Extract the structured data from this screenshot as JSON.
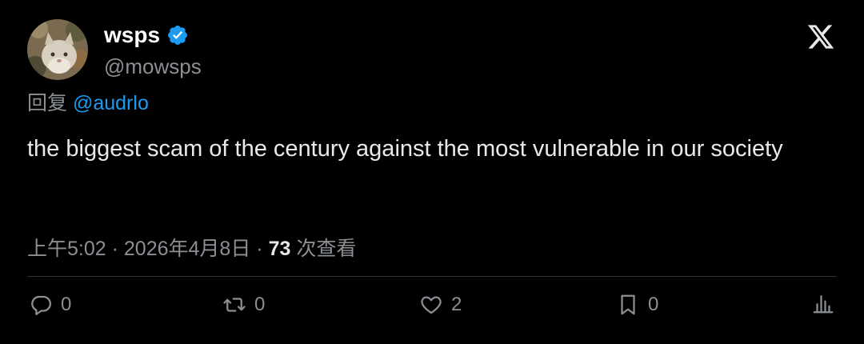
{
  "author": {
    "display_name": "wsps",
    "verified": true,
    "handle": "@mowsps",
    "avatar_icon": "cat-avatar"
  },
  "reply": {
    "prefix": "回复",
    "mention": "@audrlo"
  },
  "tweet": {
    "text": "the biggest scam of the century against the most vulnerable in our society"
  },
  "meta": {
    "time": "上午5:02",
    "separator": "·",
    "date": "2026年4月8日",
    "views_count": "73",
    "views_label": "次查看"
  },
  "actions": {
    "replies": "0",
    "reposts": "0",
    "likes": "2",
    "bookmarks": "0"
  },
  "colors": {
    "background": "#000000",
    "text": "#e7e9ea",
    "secondary": "#8b8f94",
    "accent": "#1d9bf0",
    "divider": "#2f3336"
  }
}
